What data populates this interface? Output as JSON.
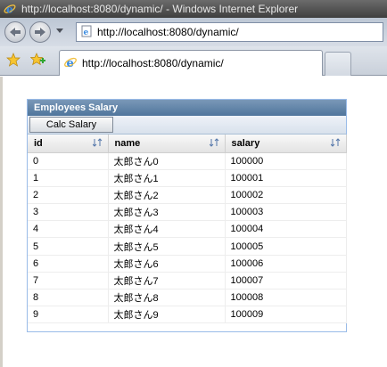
{
  "window": {
    "title": "http://localhost:8080/dynamic/ - Windows Internet Explorer",
    "url": "http://localhost:8080/dynamic/",
    "tab_label": "http://localhost:8080/dynamic/"
  },
  "colors": {
    "panel_header": "#5b7fa6",
    "panel_border": "#99bbe8"
  },
  "panel": {
    "title": "Employees Salary",
    "button_label": "Calc Salary",
    "columns": [
      "id",
      "name",
      "salary"
    ],
    "rows": [
      {
        "id": "0",
        "name": "太郎さん0",
        "salary": "100000"
      },
      {
        "id": "1",
        "name": "太郎さん1",
        "salary": "100001"
      },
      {
        "id": "2",
        "name": "太郎さん2",
        "salary": "100002"
      },
      {
        "id": "3",
        "name": "太郎さん3",
        "salary": "100003"
      },
      {
        "id": "4",
        "name": "太郎さん4",
        "salary": "100004"
      },
      {
        "id": "5",
        "name": "太郎さん5",
        "salary": "100005"
      },
      {
        "id": "6",
        "name": "太郎さん6",
        "salary": "100006"
      },
      {
        "id": "7",
        "name": "太郎さん7",
        "salary": "100007"
      },
      {
        "id": "8",
        "name": "太郎さん8",
        "salary": "100008"
      },
      {
        "id": "9",
        "name": "太郎さん9",
        "salary": "100009"
      }
    ]
  }
}
